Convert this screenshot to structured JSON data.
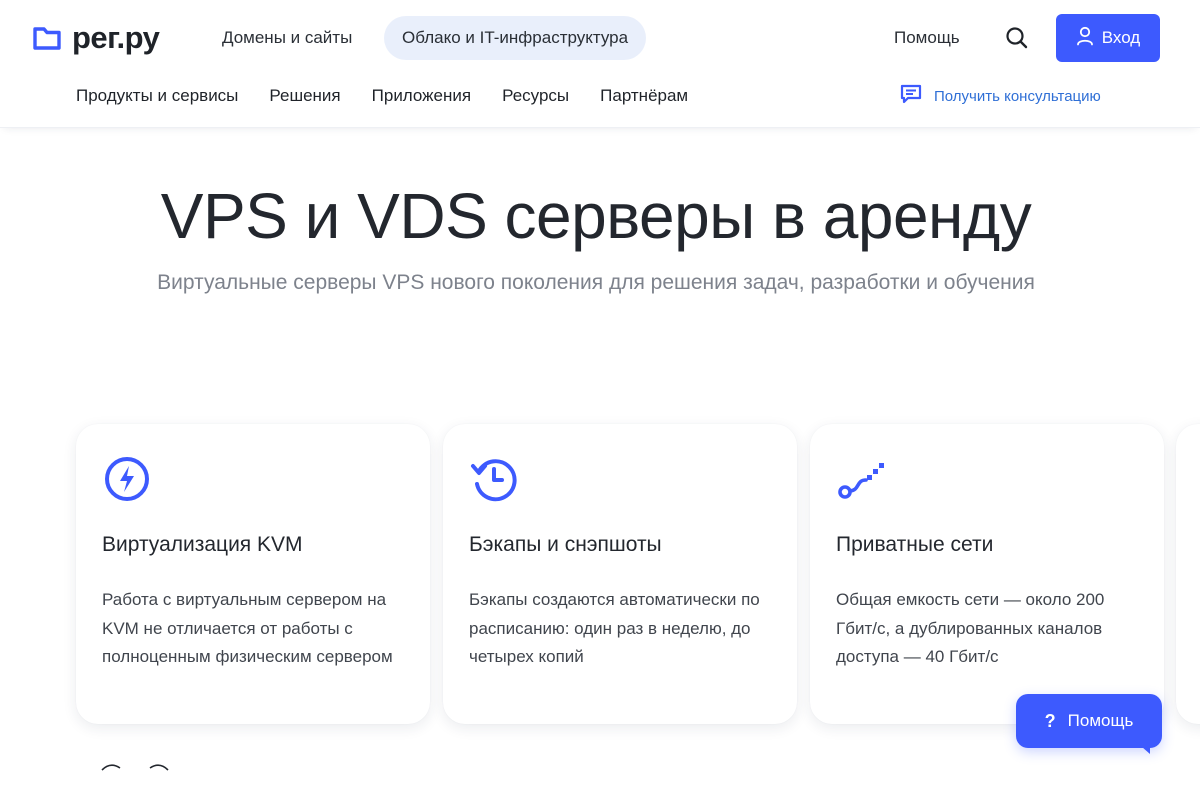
{
  "header": {
    "logo_text": "рег.ру",
    "top_nav": [
      "Домены и сайты",
      "Облако и IT-инфраструктура"
    ],
    "help_label": "Помощь",
    "login_label": "Вход",
    "sub_nav": [
      "Продукты и сервисы",
      "Решения",
      "Приложения",
      "Ресурсы",
      "Партнёрам"
    ],
    "consult_label": "Получить консультацию"
  },
  "hero": {
    "title": "VPS и VDS серверы в аренду",
    "subtitle": "Виртуальные серверы VPS нового поколения для решения задач, разработки и обучения"
  },
  "features": [
    {
      "icon": "lightning-icon",
      "title": "Виртуализация KVM",
      "description": "Работа с виртуальным сервером на KVM не отличается от работы с полноценным физическим сервером"
    },
    {
      "icon": "history-clock-icon",
      "title": "Бэкапы и снэпшоты",
      "description": "Бэкапы создаются автоматически по расписанию: один раз в неделю, до четырех копий"
    },
    {
      "icon": "network-path-icon",
      "title": "Приватные сети",
      "description": "Общая емкость сети — около 200 Гбит/с, а дублированных каналов доступа — 40 Гбит/с"
    }
  ],
  "help_button": {
    "icon": "?",
    "label": "Помощь"
  },
  "colors": {
    "accent": "#3d5afe",
    "pill_bg": "#e9effb",
    "link": "#2f6fd6",
    "muted_text": "#7d828c"
  }
}
